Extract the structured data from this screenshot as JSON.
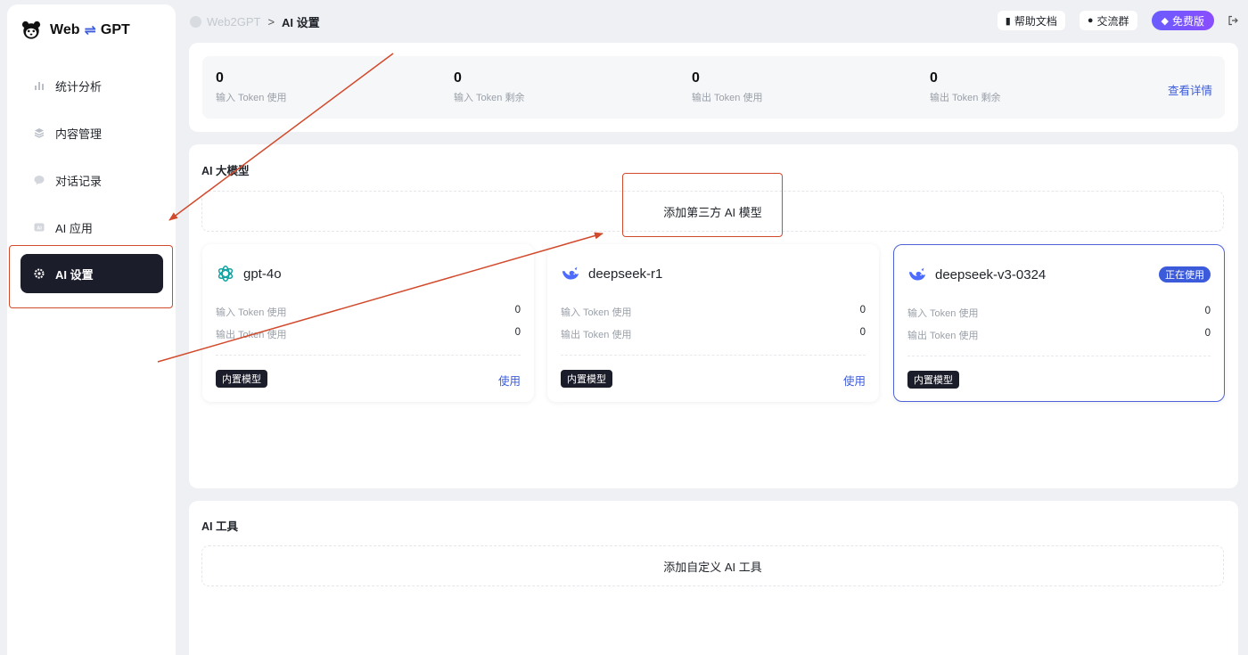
{
  "brand": {
    "name_left": "Web",
    "arrow": "⇌",
    "name_right": "GPT"
  },
  "sidebar": {
    "items": [
      {
        "label": "统计分析"
      },
      {
        "label": "内容管理"
      },
      {
        "label": "对话记录"
      },
      {
        "label": "AI 应用"
      },
      {
        "label": "AI 设置",
        "active": true
      }
    ]
  },
  "header": {
    "breadcrumb_home": "Web2GPT",
    "breadcrumb_sep": ">",
    "breadcrumb_current": "AI 设置",
    "help_label": "帮助文档",
    "group_label": "交流群",
    "plan_label": "免费版"
  },
  "stats": {
    "items": [
      {
        "value": "0",
        "label": "输入 Token 使用"
      },
      {
        "value": "0",
        "label": "输入 Token 剩余"
      },
      {
        "value": "0",
        "label": "输出 Token 使用"
      },
      {
        "value": "0",
        "label": "输出 Token 剩余"
      }
    ],
    "detail_link": "查看详情"
  },
  "models": {
    "title": "AI 大模型",
    "add_label": "添加第三方 AI 模型",
    "cards": [
      {
        "name": "gpt-4o",
        "icon": "openai-icon",
        "in_label": "输入 Token 使用",
        "in_value": "0",
        "out_label": "输出 Token 使用",
        "out_value": "0",
        "tag": "内置模型",
        "action": "使用"
      },
      {
        "name": "deepseek-r1",
        "icon": "deepseek-icon",
        "in_label": "输入 Token 使用",
        "in_value": "0",
        "out_label": "输出 Token 使用",
        "out_value": "0",
        "tag": "内置模型",
        "action": "使用"
      },
      {
        "name": "deepseek-v3-0324",
        "icon": "deepseek-icon",
        "in_label": "输入 Token 使用",
        "in_value": "0",
        "out_label": "输出 Token 使用",
        "out_value": "0",
        "tag": "内置模型",
        "badge": "正在使用"
      }
    ]
  },
  "tools": {
    "title": "AI 工具",
    "add_label": "添加自定义 AI 工具"
  },
  "colors": {
    "accent": "#3b5bdb",
    "annotation": "#d24a2c",
    "sidebar_active": "#1c1d2b"
  }
}
